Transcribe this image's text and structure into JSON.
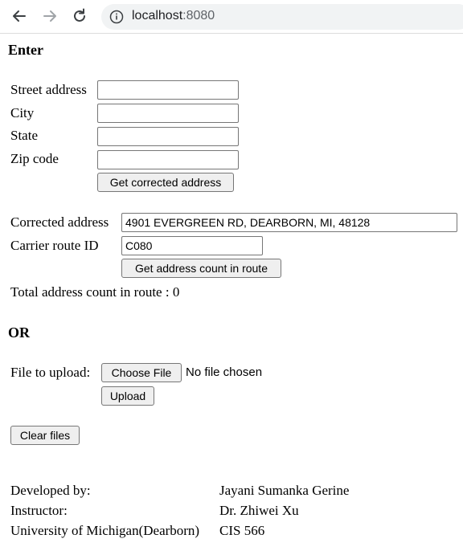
{
  "browser": {
    "host": "localhost",
    "port": ":8080",
    "icons": [
      "back-icon",
      "forward-icon",
      "reload-icon",
      "site-info-icon"
    ]
  },
  "enter_section": {
    "heading": "Enter",
    "street_label": "Street address",
    "street_value": "",
    "city_label": "City",
    "city_value": "",
    "state_label": "State",
    "state_value": "",
    "zip_label": "Zip code",
    "zip_value": "",
    "get_corrected_button": "Get corrected address"
  },
  "result_section": {
    "corrected_label": "Corrected address",
    "corrected_value": "4901 EVERGREEN RD, DEARBORN, MI, 48128",
    "carrier_label": "Carrier route ID",
    "carrier_value": "C080",
    "get_count_button": "Get address count in route",
    "total_count_text": "Total address count in route : 0"
  },
  "or_heading": "OR",
  "upload_section": {
    "file_label": "File to upload:",
    "choose_button": "Choose File",
    "no_file_text": "No file chosen",
    "upload_button": "Upload",
    "clear_button": "Clear files"
  },
  "footer": {
    "developed_label": "Developed by:",
    "developed_value": "Jayani Sumanka Gerine",
    "instructor_label": "Instructor:",
    "instructor_value": "Dr. Zhiwei Xu",
    "university_label": "University of Michigan(Dearborn)",
    "course_value": "CIS 566"
  }
}
